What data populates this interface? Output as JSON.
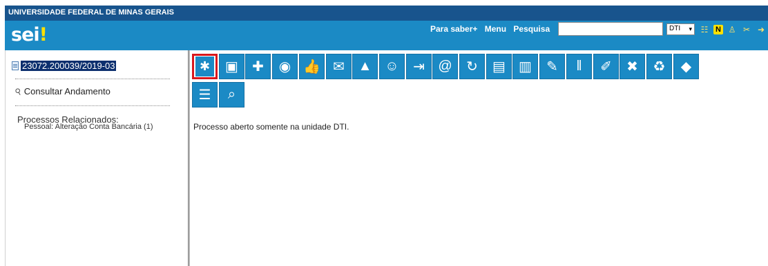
{
  "header": {
    "university": "UNIVERSIDADE FEDERAL DE MINAS GERAIS",
    "logo_text": "sei",
    "logo_mark": "!",
    "nav": [
      "Para saber+",
      "Menu",
      "Pesquisa"
    ],
    "search": {
      "value": "",
      "placeholder": ""
    },
    "unit_select": {
      "value": "DTI",
      "caret": "▾"
    },
    "icons": [
      "list-icon",
      "notification-icon",
      "user-icon",
      "tools-icon",
      "exit-icon"
    ]
  },
  "left": {
    "process_number": "23072.200039/2019-03",
    "consult_label": "Consultar Andamento",
    "related_title": "Processos Relacionados:",
    "related_items": [
      "Pessoal: Alteração Conta Bancária (1)"
    ]
  },
  "toolbar": {
    "row1": [
      {
        "name": "incluir-documento-icon",
        "glyph": "✱"
      },
      {
        "name": "iniciar-processo-relacionado-icon",
        "glyph": "▣"
      },
      {
        "name": "atribuir-processo-icon",
        "glyph": "✚"
      },
      {
        "name": "acompanhamento-especial-icon",
        "glyph": "◉"
      },
      {
        "name": "ciencia-icon",
        "glyph": "👍"
      },
      {
        "name": "enviar-correspondencia-icon",
        "glyph": "✉"
      },
      {
        "name": "incluir-bloco-icon",
        "glyph": "▲"
      },
      {
        "name": "atribuir-interessado-icon",
        "glyph": "☺"
      },
      {
        "name": "enviar-processo-icon",
        "glyph": "⇥"
      },
      {
        "name": "enviar-email-icon",
        "glyph": "@"
      },
      {
        "name": "atualizar-andamento-icon",
        "glyph": "↻"
      },
      {
        "name": "anexar-processo-icon",
        "glyph": "▤"
      },
      {
        "name": "gerenciar-disponibilizacoes-icon",
        "glyph": "▥"
      },
      {
        "name": "anotacoes-icon",
        "glyph": "✎"
      },
      {
        "name": "sobrestar-processo-icon",
        "glyph": "‖"
      },
      {
        "name": "gerar-pdf-icon",
        "glyph": "✐"
      },
      {
        "name": "excluir-icon",
        "glyph": "✖"
      },
      {
        "name": "concluir-processo-icon",
        "glyph": "♻"
      },
      {
        "name": "marcador-icon",
        "glyph": "◆"
      }
    ],
    "row2": [
      {
        "name": "listar-documentos-icon",
        "glyph": "☰"
      },
      {
        "name": "pesquisar-processo-icon",
        "glyph": "⌕"
      }
    ]
  },
  "main": {
    "message": "Processo aberto somente na unidade DTI."
  },
  "colors": {
    "brand_blue": "#1b8ac5",
    "header_dark": "#18548d",
    "highlight_red": "#d8171c",
    "logo_mark": "#ffe000"
  }
}
